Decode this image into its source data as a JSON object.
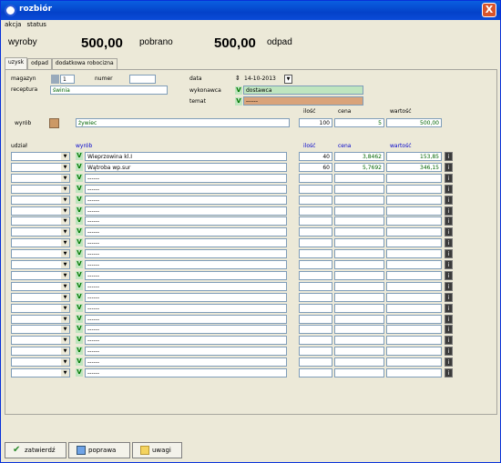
{
  "window": {
    "title": "rozbiór",
    "close_label": "X"
  },
  "menu": [
    "akcja",
    "status"
  ],
  "summary": {
    "wyroby_label": "wyroby",
    "wyroby_value": "500,00",
    "pobrano_label": "pobrano",
    "pobrano_value": "500,00",
    "odpad_label": "odpad"
  },
  "tabs": [
    "uzysk",
    "odpad",
    "dodatkowa robocizna"
  ],
  "form": {
    "magazyn_label": "magazyn",
    "magazyn_value": "1",
    "numer_label": "numer",
    "numer_value": "",
    "receptura_label": "receptura",
    "receptura_value": "świnia",
    "data_label": "data",
    "data_value": "14-10-2013",
    "wykonawca_label": "wykonawca",
    "wykonawca_value": "dostawca",
    "temat_label": "temat",
    "temat_value": "------",
    "ilosc_label": "ilość",
    "cena_label": "cena",
    "wartosc_label": "wartość",
    "wyrob_label": "wyrób",
    "wyrob_value": "żywiec",
    "wyrob_ilosc": "100",
    "wyrob_cena": "5",
    "wyrob_wartosc": "500,00"
  },
  "table": {
    "headers": {
      "udzial": "udział",
      "wyrob": "wyrób",
      "ilosc": "ilość",
      "cena": "cena",
      "wartosc": "wartość"
    },
    "rows": [
      {
        "name": "Wieprzowina kl.I",
        "ilosc": "40",
        "cena": "3,8462",
        "wartosc": "153,85"
      },
      {
        "name": "Wątroba wp.sur",
        "ilosc": "60",
        "cena": "5,7692",
        "wartosc": "346,15"
      },
      {
        "name": "------",
        "ilosc": "",
        "cena": "",
        "wartosc": ""
      },
      {
        "name": "------",
        "ilosc": "",
        "cena": "",
        "wartosc": ""
      },
      {
        "name": "------",
        "ilosc": "",
        "cena": "",
        "wartosc": ""
      },
      {
        "name": "------",
        "ilosc": "",
        "cena": "",
        "wartosc": ""
      },
      {
        "name": "------",
        "ilosc": "",
        "cena": "",
        "wartosc": ""
      },
      {
        "name": "------",
        "ilosc": "",
        "cena": "",
        "wartosc": ""
      },
      {
        "name": "------",
        "ilosc": "",
        "cena": "",
        "wartosc": ""
      },
      {
        "name": "------",
        "ilosc": "",
        "cena": "",
        "wartosc": ""
      },
      {
        "name": "------",
        "ilosc": "",
        "cena": "",
        "wartosc": ""
      },
      {
        "name": "------",
        "ilosc": "",
        "cena": "",
        "wartosc": ""
      },
      {
        "name": "------",
        "ilosc": "",
        "cena": "",
        "wartosc": ""
      },
      {
        "name": "------",
        "ilosc": "",
        "cena": "",
        "wartosc": ""
      },
      {
        "name": "------",
        "ilosc": "",
        "cena": "",
        "wartosc": ""
      },
      {
        "name": "------",
        "ilosc": "",
        "cena": "",
        "wartosc": ""
      },
      {
        "name": "------",
        "ilosc": "",
        "cena": "",
        "wartosc": ""
      },
      {
        "name": "------",
        "ilosc": "",
        "cena": "",
        "wartosc": ""
      },
      {
        "name": "------",
        "ilosc": "",
        "cena": "",
        "wartosc": ""
      },
      {
        "name": "------",
        "ilosc": "",
        "cena": "",
        "wartosc": ""
      },
      {
        "name": "------",
        "ilosc": "",
        "cena": "",
        "wartosc": ""
      }
    ]
  },
  "footer": {
    "zatwierdz": "zatwierdź",
    "poprawa": "poprawa",
    "uwagi": "uwagi"
  },
  "colors": {
    "titlebar": "#0442c9",
    "wykonawca_bg": "#bfe5bf",
    "temat_bg": "#d9a37a",
    "green_text": "#006400"
  }
}
